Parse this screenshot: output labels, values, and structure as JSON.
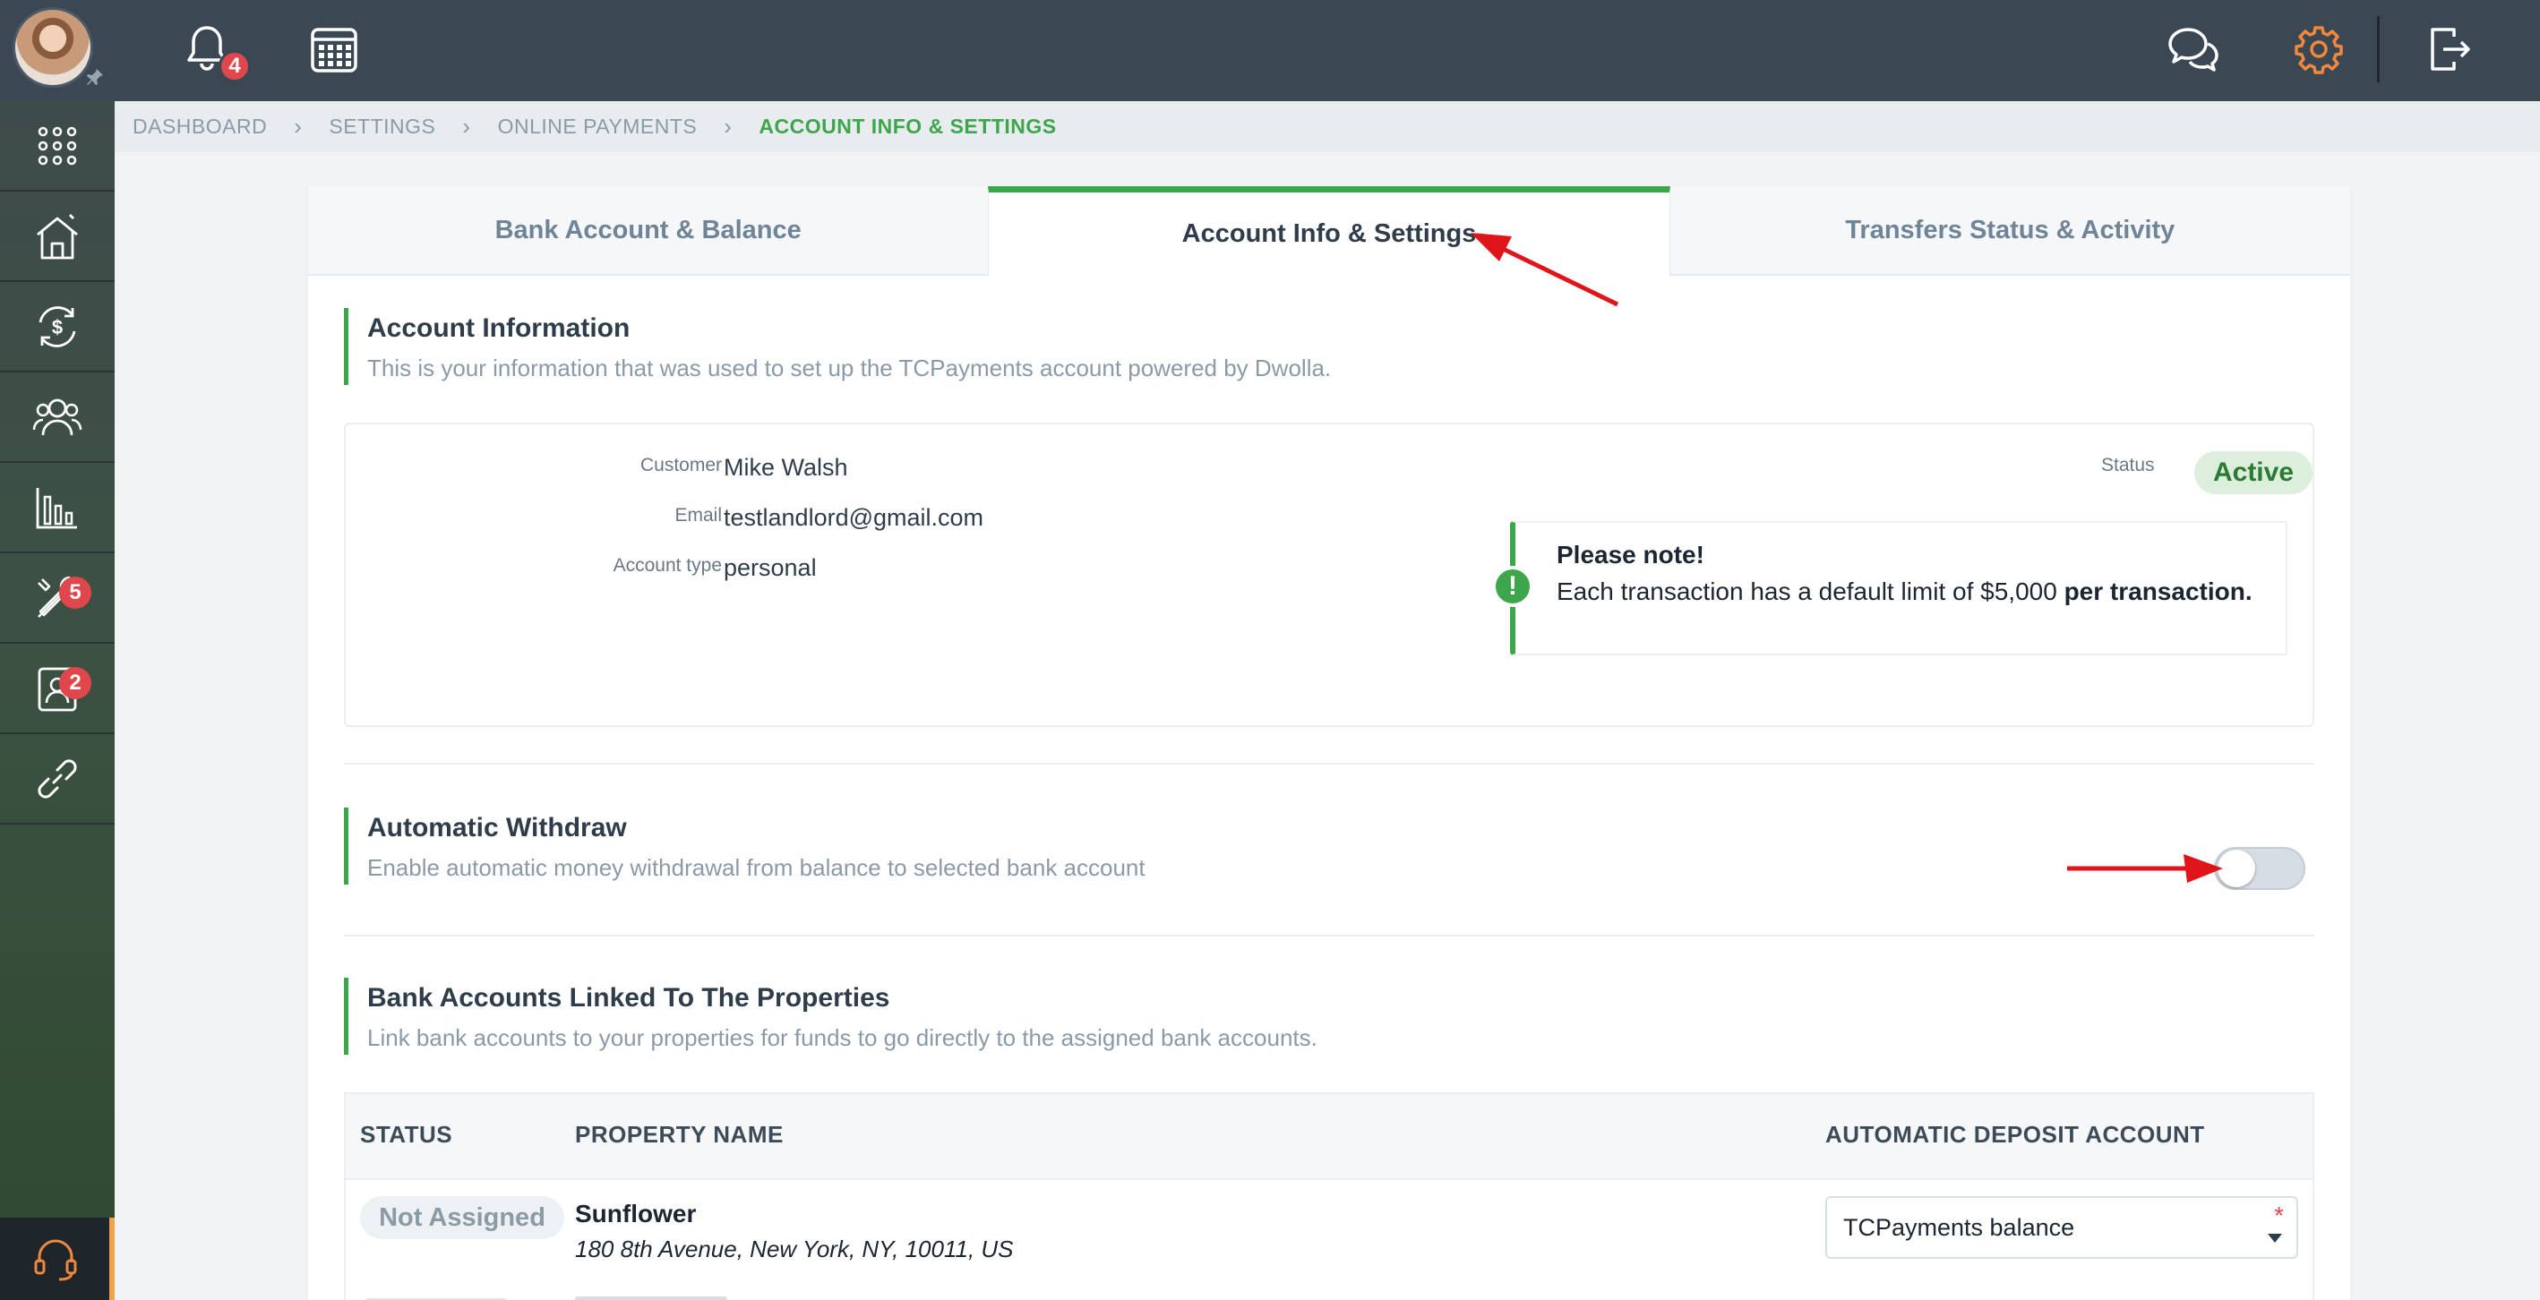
{
  "topbar": {
    "notifications_count": "4",
    "icons": [
      "bell-icon",
      "calendar-icon",
      "chat-icon",
      "settings-icon",
      "logout-icon"
    ]
  },
  "sidebar": {
    "items": [
      {
        "name": "apps-grid-icon",
        "badge": ""
      },
      {
        "name": "properties-icon",
        "badge": ""
      },
      {
        "name": "payments-icon",
        "badge": ""
      },
      {
        "name": "tenants-icon",
        "badge": ""
      },
      {
        "name": "reports-icon",
        "badge": ""
      },
      {
        "name": "maintenance-icon",
        "badge": "5"
      },
      {
        "name": "applications-icon",
        "badge": "2"
      },
      {
        "name": "link-icon",
        "badge": ""
      }
    ]
  },
  "breadcrumb": {
    "items": [
      "DASHBOARD",
      "SETTINGS",
      "ONLINE PAYMENTS",
      "ACCOUNT INFO & SETTINGS"
    ]
  },
  "tabs": {
    "items": [
      "Bank Account & Balance",
      "Account Info & Settings",
      "Transfers Status & Activity"
    ],
    "active": "Account Info & Settings"
  },
  "account_info": {
    "title": "Account Information",
    "description": "This is your information that was used to set up the TCPayments account powered by Dwolla.",
    "customer_label": "Customer",
    "customer_value": "Mike Walsh",
    "email_label": "Email",
    "email_value": "testlandlord@gmail.com",
    "account_type_label": "Account type",
    "account_type_value": "personal",
    "status_label": "Status",
    "status_value": "Active",
    "note_title": "Please note!",
    "note_body_prefix": "Each transaction has a default limit of $5,000 ",
    "note_body_bold": "per transaction."
  },
  "auto_withdraw": {
    "title": "Automatic Withdraw",
    "description": "Enable automatic money withdrawal from balance to selected bank account",
    "enabled": false
  },
  "linked_accounts": {
    "title": "Bank Accounts Linked To The Properties",
    "description": "Link bank accounts to your properties for funds to go directly to the assigned bank accounts.",
    "columns": [
      "STATUS",
      "PROPERTY NAME",
      "AUTOMATIC DEPOSIT ACCOUNT"
    ],
    "rows": [
      {
        "status": "Not Assigned",
        "property_name": "Sunflower",
        "address": "180 8th Avenue, New York, NY, 10011, US",
        "deposit_account": "TCPayments balance",
        "required_mark": "*"
      }
    ]
  },
  "colors": {
    "accent": "#3ea64a",
    "topbar": "#3b4753",
    "badge": "#e0474c",
    "annotation_arrow": "#e0141b"
  }
}
